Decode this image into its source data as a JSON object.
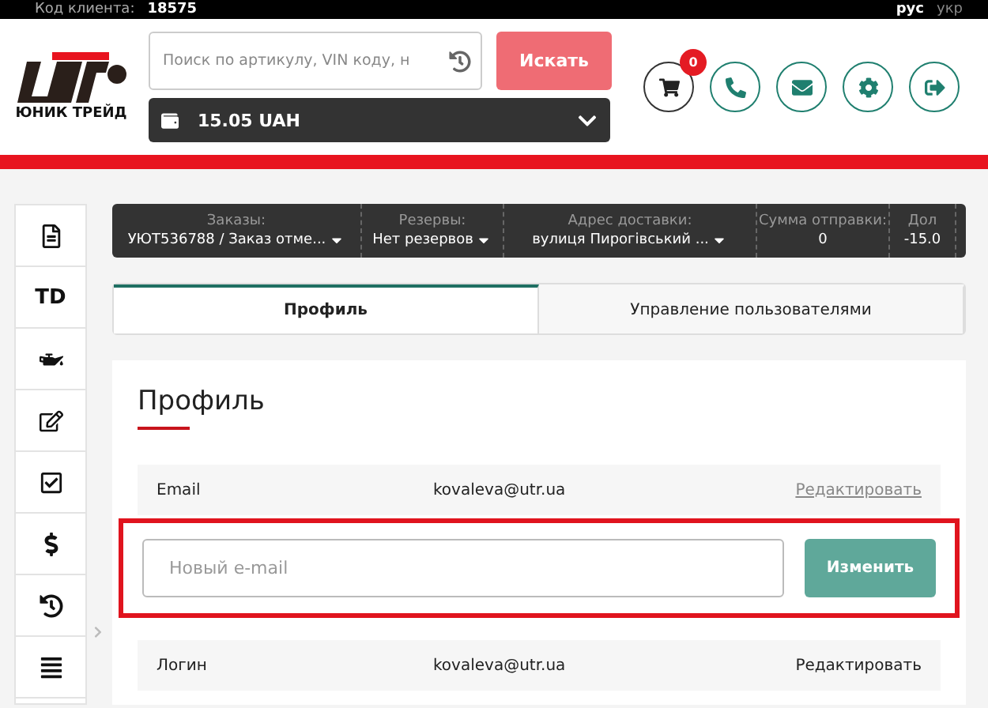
{
  "top_bar": {
    "client_label": "Код клиента:",
    "client_code": "18575",
    "languages": [
      {
        "label": "рус",
        "selected": true
      },
      {
        "label": "укр",
        "selected": false
      }
    ]
  },
  "header": {
    "logo_text": "ЮНИК ТРЕЙД",
    "search": {
      "placeholder": "Поиск по артикулу, VIN коду, н"
    },
    "search_button": "Искать",
    "balance": "15.05 UAH",
    "cart_count": "0"
  },
  "sidebar": {
    "td_label": "TD"
  },
  "info_bar": [
    {
      "label": "Заказы:",
      "value": "УЮТ536788 / Заказ отме...",
      "dropdown": true
    },
    {
      "label": "Резервы:",
      "value": "Нет резервов",
      "dropdown": true
    },
    {
      "label": "Адрес доставки:",
      "value": "вулиця Пирогівський ...",
      "dropdown": true
    },
    {
      "label": "Сумма отправки:",
      "value": "0"
    },
    {
      "label": "Дол",
      "value": "-15.0"
    }
  ],
  "tabs": [
    {
      "label": "Профиль",
      "selected": true
    },
    {
      "label": "Управление пользователями",
      "selected": false
    }
  ],
  "profile": {
    "title": "Профиль",
    "fields": [
      {
        "kind": "row",
        "label": "Email",
        "value": "kovaleva@utr.ua",
        "action": "Редактировать",
        "underlined": true
      },
      {
        "kind": "form",
        "placeholder": "Новый e-mail",
        "button": "Изменить",
        "highlighted": true
      },
      {
        "kind": "row",
        "label": "Логин",
        "value": "kovaleva@utr.ua",
        "action": "Редактировать",
        "underlined": false
      }
    ]
  }
}
